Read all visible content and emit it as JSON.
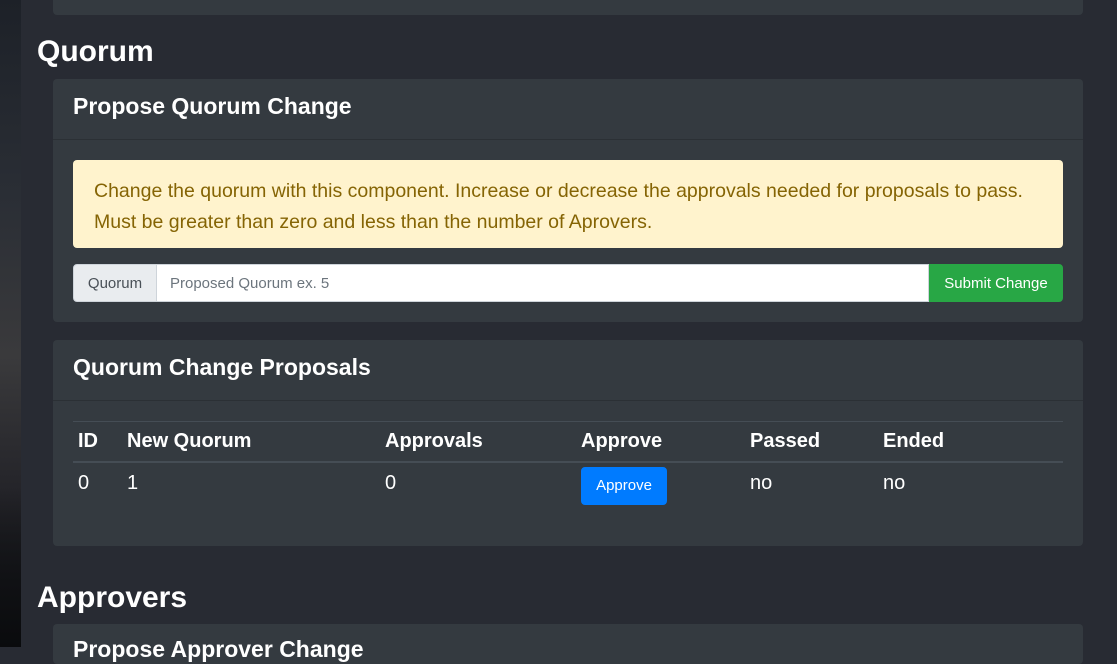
{
  "quorum_section": {
    "heading": "Quorum",
    "propose_card": {
      "title": "Propose Quorum Change",
      "alert_text": "Change the quorum with this component. Increase or decrease the approvals needed for proposals to pass. Must be greater than zero and less than the number of Aprovers.",
      "input_label": "Quorum",
      "input_placeholder": "Proposed Quorum ex. 5",
      "input_value": "",
      "submit_label": "Submit Change"
    },
    "proposals_card": {
      "title": "Quorum Change Proposals",
      "columns": [
        "ID",
        "New Quorum",
        "Approvals",
        "Approve",
        "Passed",
        "Ended"
      ],
      "rows": [
        {
          "id": "0",
          "new_quorum": "1",
          "approvals": "0",
          "approve_label": "Approve",
          "passed": "no",
          "ended": "no"
        }
      ]
    }
  },
  "approvers_section": {
    "heading": "Approvers",
    "next_card_title": "Propose Approver Change"
  },
  "colors": {
    "page_bg": "#282b33",
    "card_bg": "#343a40",
    "alert_bg": "#fff3cd",
    "alert_text": "#856404",
    "submit_button": "#28a745",
    "approve_button": "#007bff"
  }
}
